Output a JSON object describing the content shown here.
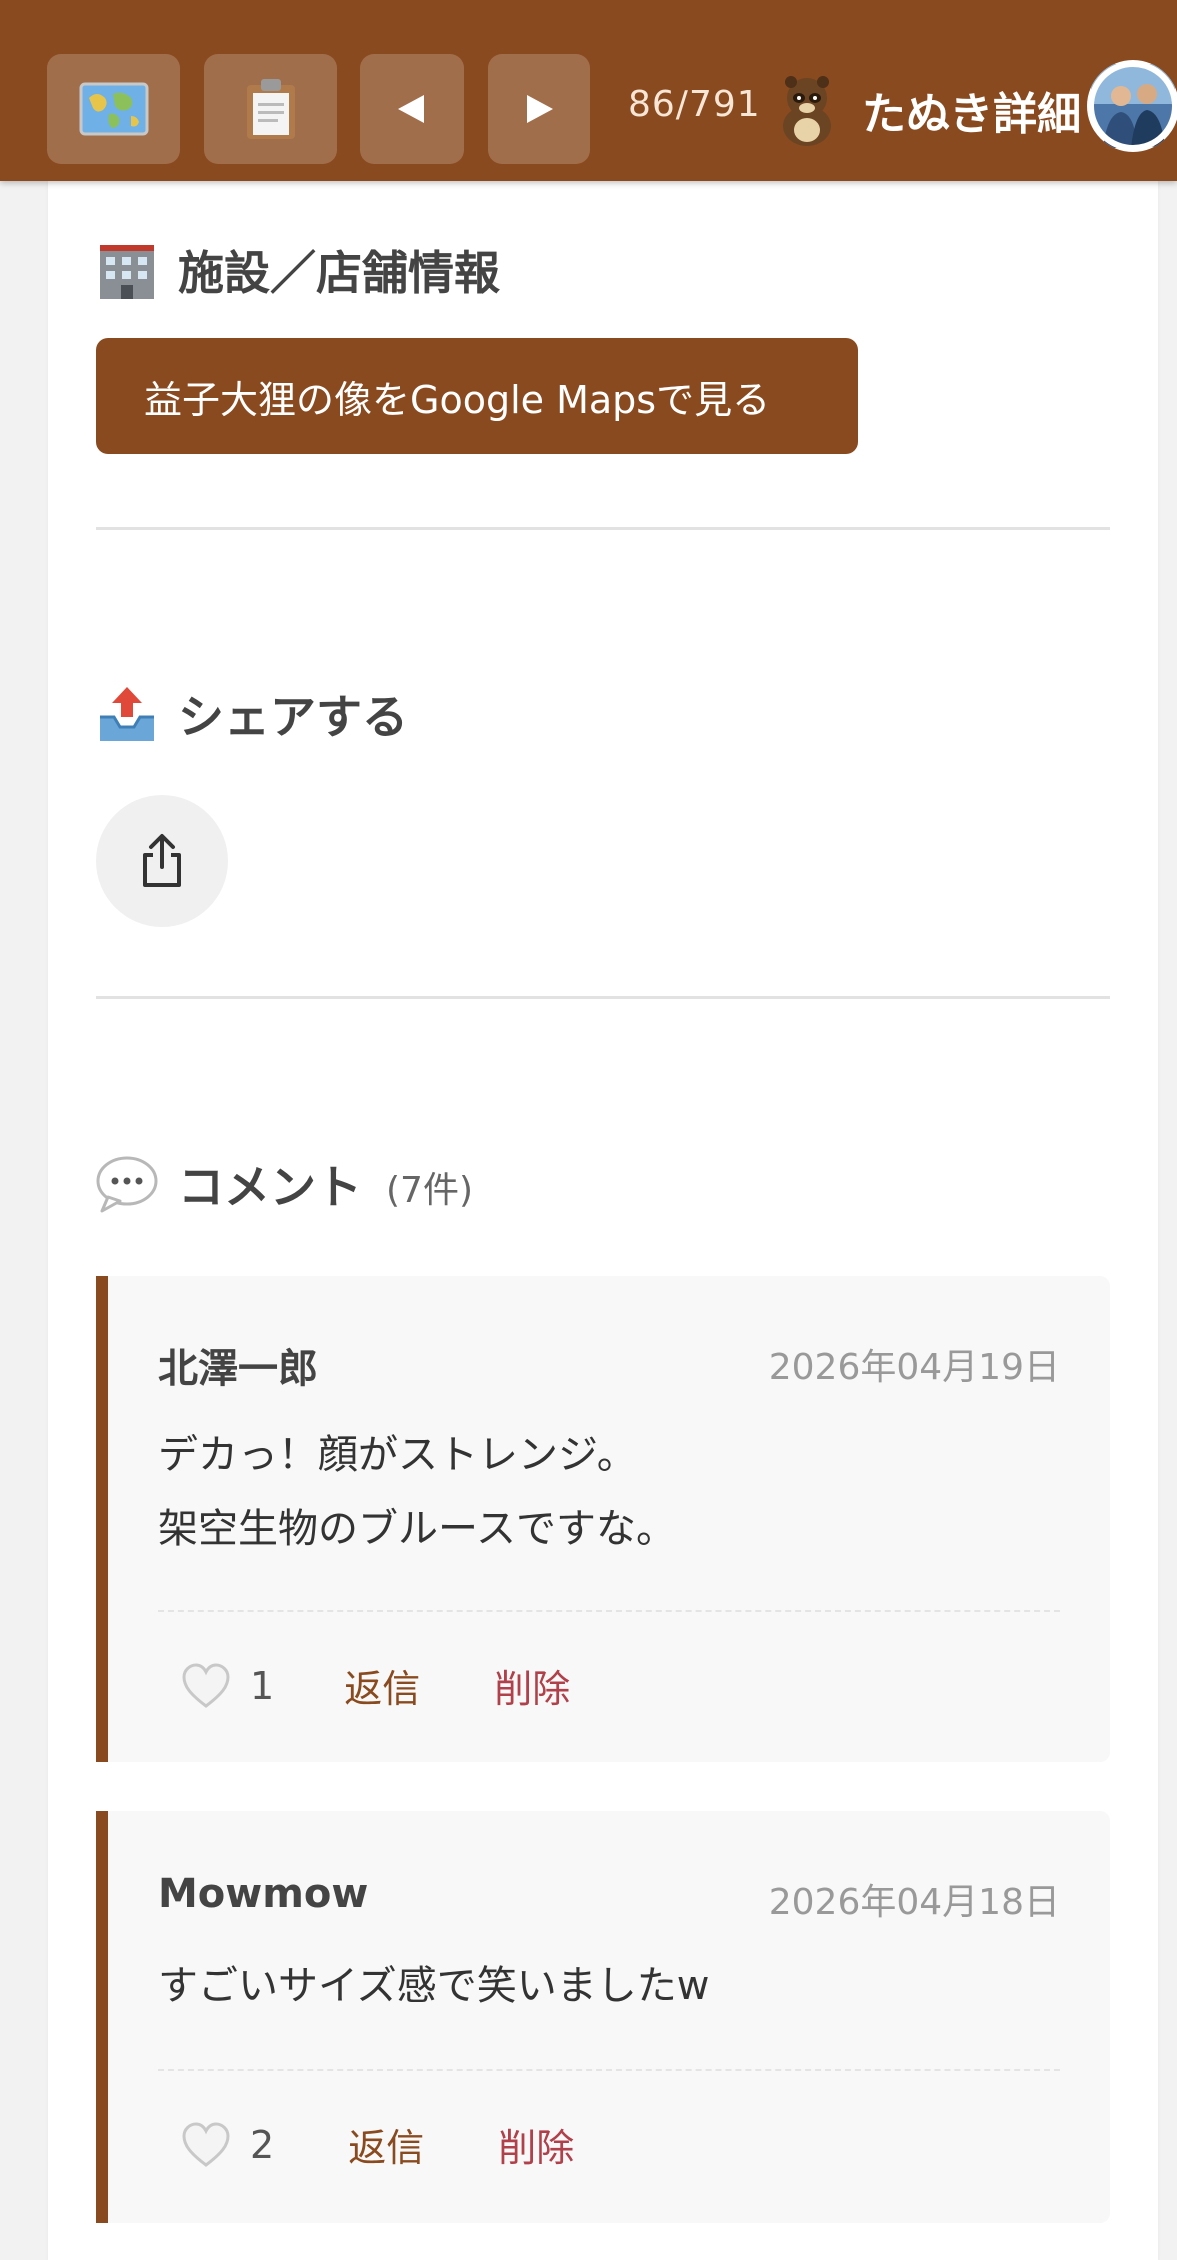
{
  "header": {
    "map_icon": "map-icon",
    "list_icon": "clipboard-icon",
    "prev_icon": "triangle-left-icon",
    "next_icon": "triangle-right-icon",
    "counter": "86/791",
    "title": "たぬき詳細",
    "accent": "#8a4a1f"
  },
  "facility": {
    "title": "施設／店舗情報",
    "icon": "office-building-icon",
    "maps_button": "益子大狸の像をGoogle Mapsで見る"
  },
  "share": {
    "title": "シェアする",
    "icon": "outbox-tray-icon",
    "share_button_icon": "share-icon"
  },
  "comments": {
    "title": "コメント",
    "count": "(7件)",
    "icon": "speech-bubble-icon",
    "items": [
      {
        "author": "北澤一郎",
        "date": "2026年04月19日",
        "lines": [
          "デカっ！顔がストレンジ。",
          "架空生物のブルースですな。"
        ],
        "likes": "1",
        "reply": "返信",
        "delete": "削除"
      },
      {
        "author": "Mowmow",
        "date": "2026年04月18日",
        "lines": [
          "すごいサイズ感で笑いましたw"
        ],
        "likes": "2",
        "reply": "返信",
        "delete": "削除"
      }
    ]
  }
}
